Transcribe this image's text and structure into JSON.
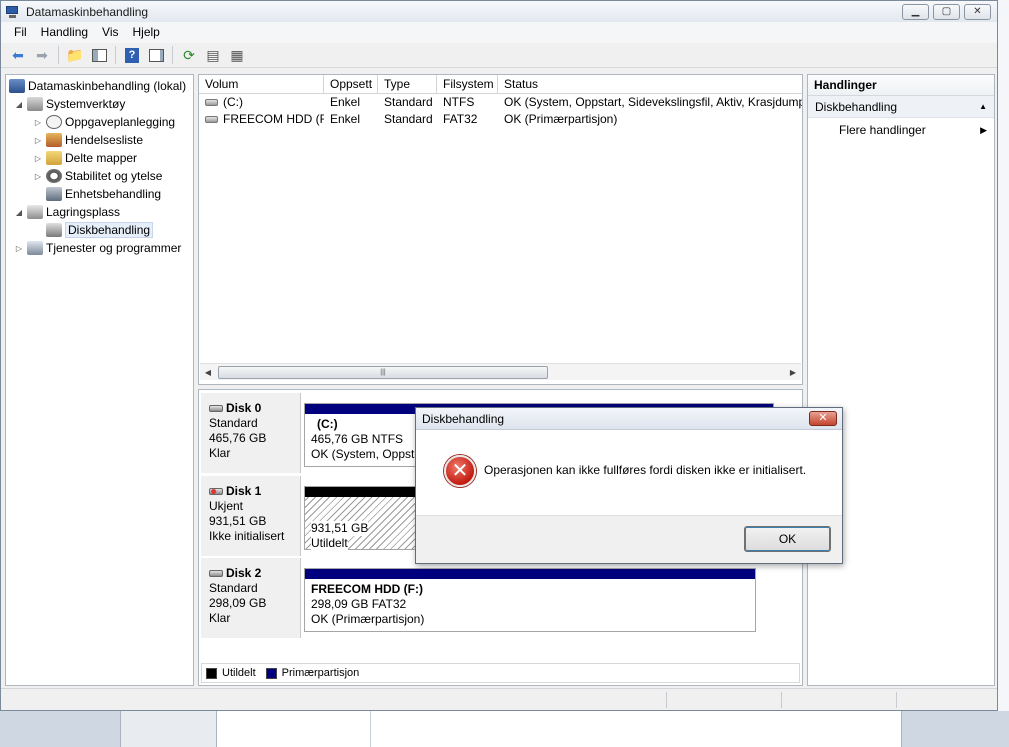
{
  "window": {
    "title": "Datamaskinbehandling"
  },
  "menu": [
    "Fil",
    "Handling",
    "Vis",
    "Hjelp"
  ],
  "tree": {
    "root": "Datamaskinbehandling (lokal)",
    "items": [
      {
        "label": "Systemverktøy",
        "level": 1
      },
      {
        "label": "Oppgaveplanlegging",
        "level": 2
      },
      {
        "label": "Hendelsesliste",
        "level": 2
      },
      {
        "label": "Delte mapper",
        "level": 2
      },
      {
        "label": "Stabilitet og ytelse",
        "level": 2
      },
      {
        "label": "Enhetsbehandling",
        "level": 2
      },
      {
        "label": "Lagringsplass",
        "level": 1
      },
      {
        "label": "Diskbehandling",
        "level": 2
      },
      {
        "label": "Tjenester og programmer",
        "level": 1
      }
    ]
  },
  "volumes": {
    "headers": [
      "Volum",
      "Oppsett",
      "Type",
      "Filsystem",
      "Status"
    ],
    "rows": [
      [
        "(C:)",
        "Enkel",
        "Standard",
        "NTFS",
        "OK (System, Oppstart, Sidevekslingsfil, Aktiv, Krasjdump,"
      ],
      [
        "FREECOM HDD (F:)",
        "Enkel",
        "Standard",
        "FAT32",
        "OK (Primærpartisjon)"
      ]
    ]
  },
  "disks": [
    {
      "name": "Disk 0",
      "type": "Standard",
      "size": "465,76 GB",
      "state": "Klar",
      "part_name": "(C:)",
      "part_size": "465,76 GB NTFS",
      "part_status": "OK (System, Oppsta"
    },
    {
      "name": "Disk 1",
      "type": "Ukjent",
      "size": "931,51 GB",
      "state": "Ikke initialisert",
      "part_name": "",
      "part_size": "931,51 GB",
      "part_status": "Utildelt"
    },
    {
      "name": "Disk 2",
      "type": "Standard",
      "size": "298,09 GB",
      "state": "Klar",
      "part_name": "FREECOM HDD  (F:)",
      "part_size": "298,09 GB FAT32",
      "part_status": "OK (Primærpartisjon)"
    }
  ],
  "legend": [
    {
      "label": "Utildelt",
      "color": "#000000"
    },
    {
      "label": "Primærpartisjon",
      "color": "#00007f"
    }
  ],
  "actions": {
    "header": "Handlinger",
    "section": "Diskbehandling",
    "item": "Flere handlinger"
  },
  "dialog": {
    "title": "Diskbehandling",
    "message": "Operasjonen kan ikke fullføres fordi disken ikke er initialisert.",
    "ok": "OK"
  },
  "colors": {
    "primary_partition": "#00007f",
    "unallocated": "#000000",
    "error": "#c21b10"
  }
}
